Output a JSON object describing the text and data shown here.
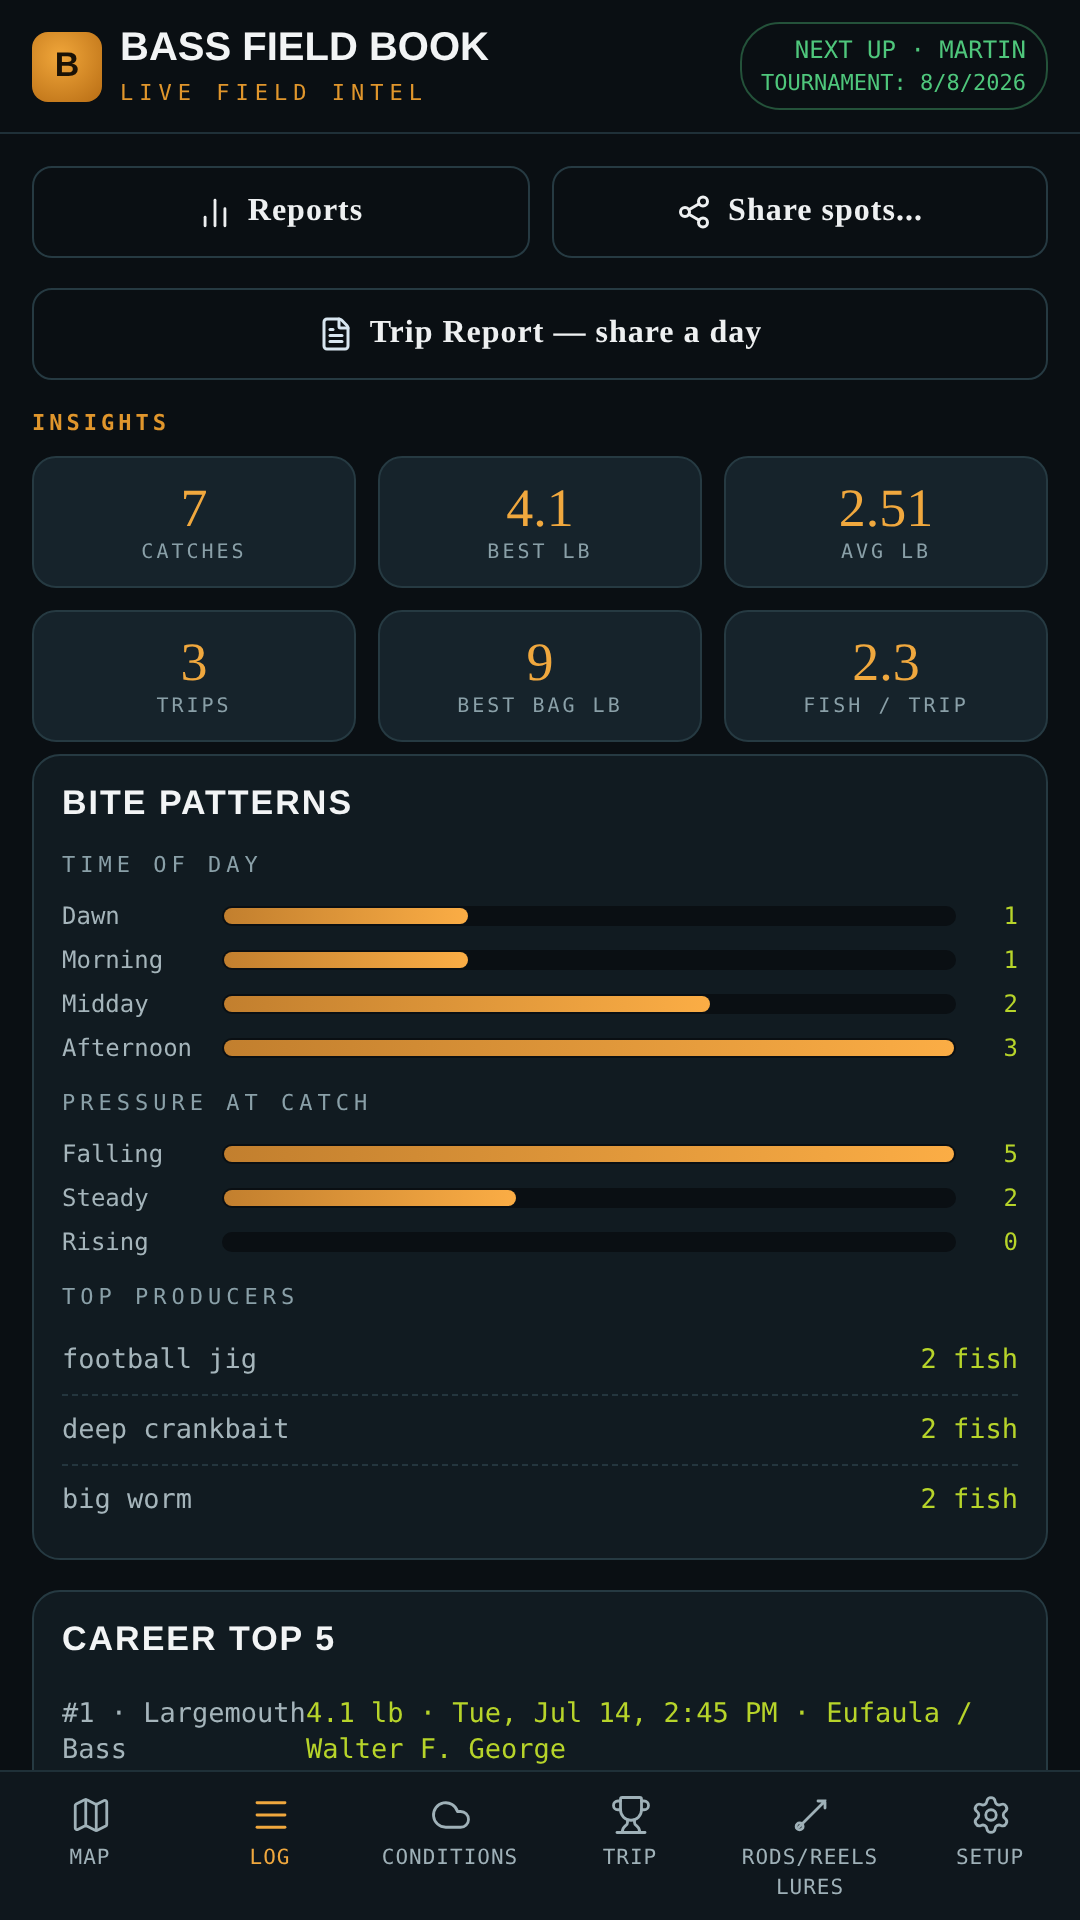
{
  "header": {
    "logo": "B",
    "title": "BASS FIELD BOOK",
    "subtitle": "LIVE FIELD INTEL",
    "next_up": {
      "line_1": "NEXT UP · MARTIN",
      "line_2": "TOURNAMENT: 8/8/2026"
    }
  },
  "actions": [
    {
      "kind": "chart",
      "label": "Reports"
    },
    {
      "kind": "share",
      "label": "Share spots..."
    },
    {
      "kind": "document",
      "label": "Trip Report — share a day"
    }
  ],
  "insights": {
    "heading": "INSIGHTS",
    "stats": [
      {
        "value": "7",
        "label": "CATCHES"
      },
      {
        "value": "4.1",
        "label": "BEST LB"
      },
      {
        "value": "2.51",
        "label": "AVG LB"
      },
      {
        "value": "3",
        "label": "TRIPS"
      },
      {
        "value": "9",
        "label": "BEST BAG LB"
      },
      {
        "value": "2.3",
        "label": "FISH / TRIP"
      }
    ]
  },
  "bite_patterns": {
    "title": "BITE PATTERNS",
    "groups": [
      {
        "heading": "TIME OF DAY",
        "rows": [
          {
            "label": "Dawn",
            "level": 0.333,
            "count": "1"
          },
          {
            "label": "Morning",
            "level": 0.333,
            "count": "1"
          },
          {
            "label": "Midday",
            "level": 0.667,
            "count": "2"
          },
          {
            "label": "Afternoon",
            "level": 1,
            "count": "3"
          }
        ]
      },
      {
        "heading": "PRESSURE AT CATCH",
        "rows": [
          {
            "label": "Falling",
            "level": 1,
            "count": "5"
          },
          {
            "label": "Steady",
            "level": 0.4,
            "count": "2"
          },
          {
            "label": "Rising",
            "level": 0,
            "count": "0"
          }
        ]
      }
    ],
    "producers_heading": "TOP PRODUCERS",
    "producers": [
      {
        "name": "football jig",
        "count": "2 fish"
      },
      {
        "name": "deep crankbait",
        "count": "2 fish"
      },
      {
        "name": "big worm",
        "count": "2 fish"
      }
    ]
  },
  "career_top": {
    "title": "CAREER TOP 5",
    "entries": [
      {
        "rank": "#1 · Largemouth Bass",
        "detail": "4.1 lb · Tue, Jul 14, 2:45 PM · Eufaula / Walter F. George"
      }
    ]
  },
  "nav": [
    {
      "kind": "map",
      "label": "MAP",
      "selected": false
    },
    {
      "kind": "log",
      "label": "LOG",
      "selected": true
    },
    {
      "kind": "cloud",
      "label": "CONDITIONS",
      "selected": false
    },
    {
      "kind": "trophy",
      "label": "TRIP",
      "selected": false
    },
    {
      "kind": "rod",
      "label": "RODS/REELS LURES",
      "selected": false
    },
    {
      "kind": "settings",
      "label": "SETUP",
      "selected": false
    }
  ]
}
